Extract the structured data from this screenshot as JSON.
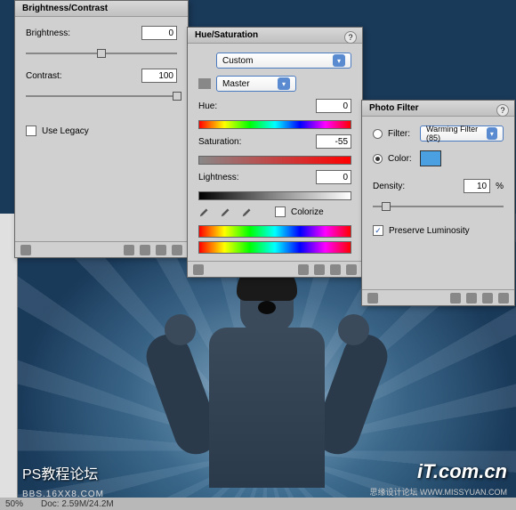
{
  "panels": {
    "bc": {
      "title": "Brightness/Contrast",
      "brightness_label": "Brightness:",
      "brightness_value": "0",
      "contrast_label": "Contrast:",
      "contrast_value": "100",
      "legacy_label": "Use Legacy"
    },
    "hs": {
      "title": "Hue/Saturation",
      "preset_value": "Custom",
      "channel_value": "Master",
      "hue_label": "Hue:",
      "hue_value": "0",
      "sat_label": "Saturation:",
      "sat_value": "-55",
      "light_label": "Lightness:",
      "light_value": "0",
      "colorize_label": "Colorize"
    },
    "pf": {
      "title": "Photo Filter",
      "filter_label": "Filter:",
      "filter_value": "Warming Filter (85)",
      "color_label": "Color:",
      "color_hex": "#4aa0e0",
      "density_label": "Density:",
      "density_value": "10",
      "density_unit": "%",
      "preserve_label": "Preserve Luminosity"
    }
  },
  "watermarks": {
    "left1": "PS教程论坛",
    "left2": "BBS.16XX8.COM",
    "right1": "iT.com.cn",
    "right2": "思缘设计论坛  WWW.MISSYUAN.COM"
  },
  "status": {
    "zoom": "50%",
    "doc": "Doc: 2.59M/24.2M"
  }
}
